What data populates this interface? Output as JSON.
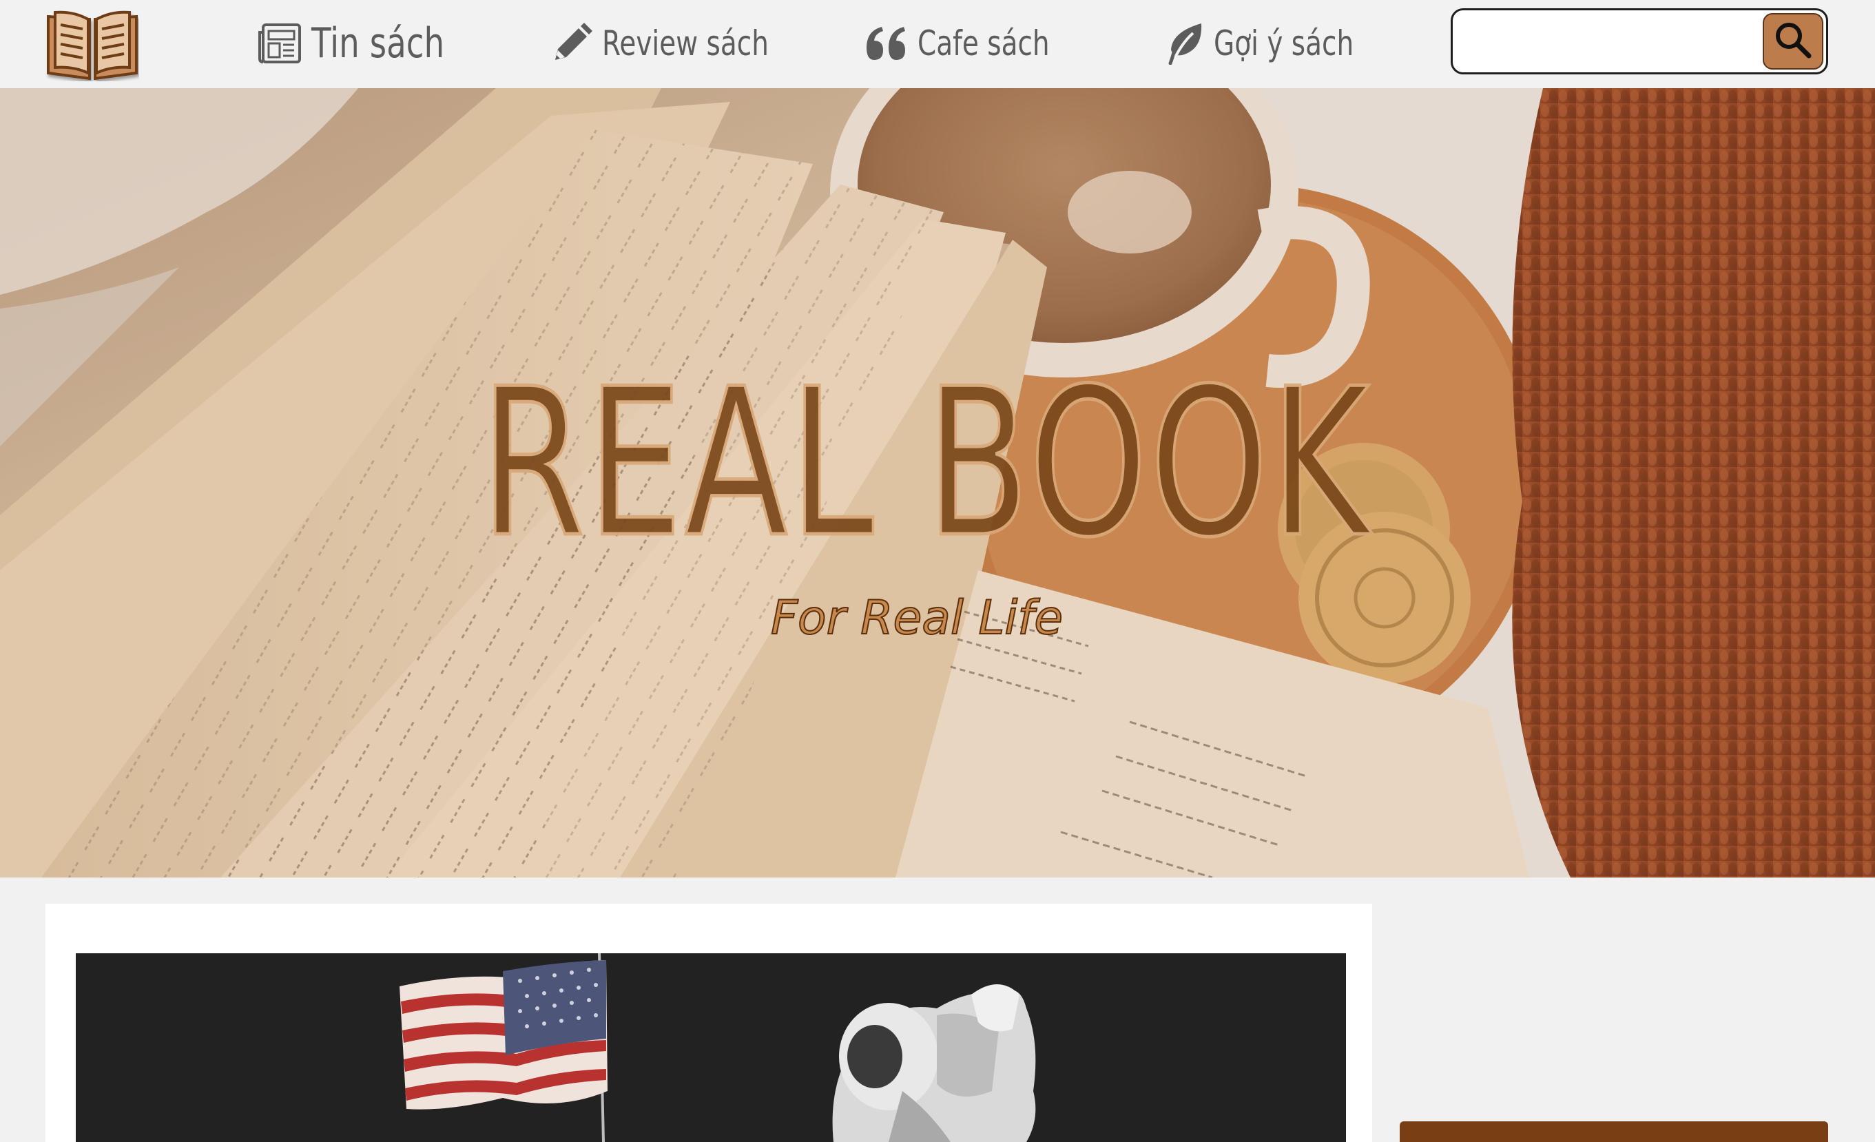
{
  "nav": {
    "items": [
      {
        "label": "Tin sách",
        "icon": "newspaper-icon"
      },
      {
        "label": "Review sách",
        "icon": "pencil-icon"
      },
      {
        "label": "Cafe sách",
        "icon": "quote-icon"
      },
      {
        "label": "Gợi ý sách",
        "icon": "leaf-icon"
      }
    ],
    "logo_icon": "open-book-icon"
  },
  "search": {
    "value": "",
    "placeholder": "",
    "button_icon": "search-icon"
  },
  "hero": {
    "title": "REAL BOOK",
    "subtitle": "For Real Life"
  },
  "colors": {
    "brand_brown": "#7a3e14",
    "accent_tan": "#bc7c4c",
    "nav_text": "#5c5c5c"
  }
}
